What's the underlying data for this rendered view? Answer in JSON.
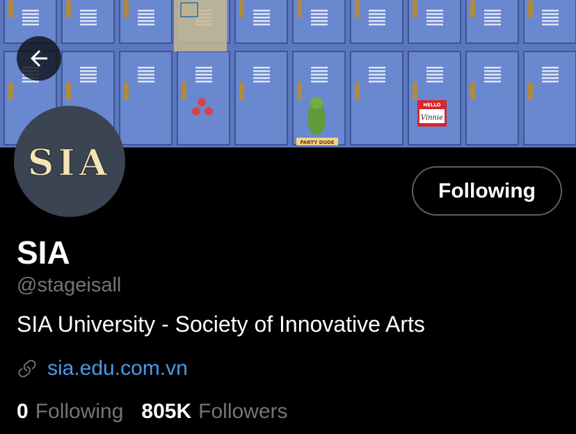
{
  "banner": {
    "sticker_name_tag_top": "HELLO",
    "sticker_name_tag_name": "Vinnie",
    "sticker_party": "PARTY DUDE"
  },
  "avatar": {
    "logo_text": "SIA"
  },
  "profile": {
    "follow_button_label": "Following",
    "display_name": "SIA",
    "handle": "@stageisall",
    "bio": "SIA University - Society of Innovative Arts",
    "website": "sia.edu.com.vn",
    "following_count": "0",
    "following_label": "Following",
    "followers_count": "805K",
    "followers_label": "Followers"
  },
  "icons": {
    "back": "arrow-left-icon",
    "link": "link-icon"
  },
  "colors": {
    "background": "#000000",
    "locker_blue": "#5f7cc4",
    "link_blue": "#4a99e9",
    "muted_text": "#71767b",
    "avatar_bg": "#3a4452",
    "logo_cream": "#f2e4b5"
  }
}
